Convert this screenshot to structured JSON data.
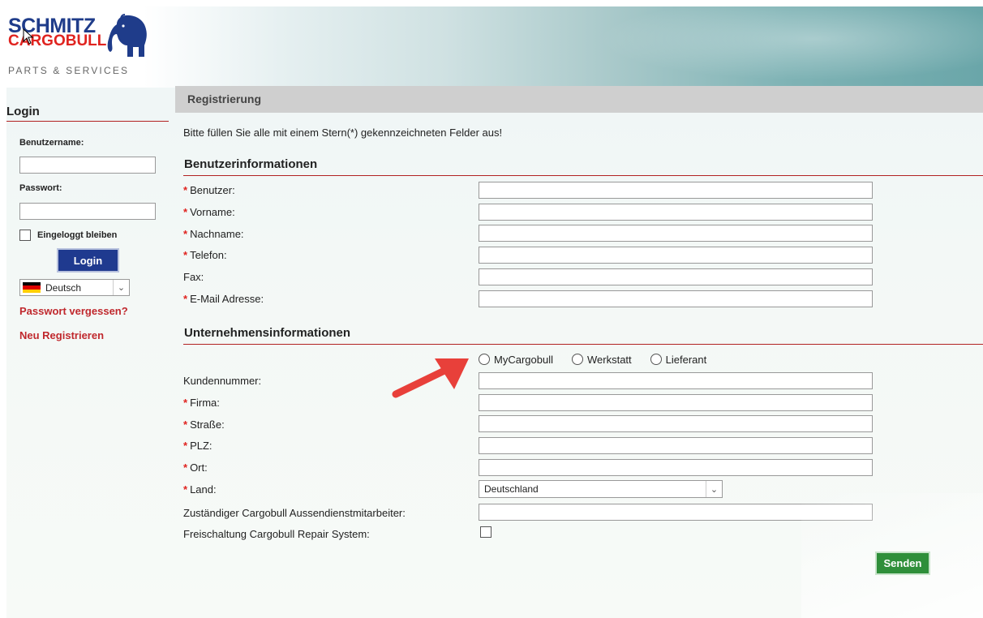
{
  "logo": {
    "line1": "SCHMITZ",
    "line2": "CARGOBULL",
    "subtitle": "PARTS & SERVICES"
  },
  "sidebar": {
    "title": "Login",
    "username_label": "Benutzername:",
    "password_label": "Passwort:",
    "stay_logged_in_label": "Eingeloggt bleiben",
    "login_button": "Login",
    "language": "Deutsch",
    "forgot_password": "Passwort vergessen?",
    "register": "Neu Registrieren"
  },
  "main": {
    "bar_title": "Registrierung",
    "intro": "Bitte füllen Sie alle mit einem Stern(*) gekennzeichneten Felder aus!",
    "section_user": "Benutzerinformationen",
    "user_fields": [
      {
        "label": "Benutzer:",
        "required": true
      },
      {
        "label": "Vorname:",
        "required": true
      },
      {
        "label": "Nachname:",
        "required": true
      },
      {
        "label": "Telefon:",
        "required": true
      },
      {
        "label": "Fax:",
        "required": false
      },
      {
        "label": "E-Mail Adresse:",
        "required": true
      }
    ],
    "section_company": "Unternehmensinformationen",
    "radio_options": [
      "MyCargobull",
      "Werkstatt",
      "Lieferant"
    ],
    "company_fields": [
      {
        "label": "Kundennummer:",
        "required": false
      },
      {
        "label": "Firma:",
        "required": true
      },
      {
        "label": "Straße:",
        "required": true
      },
      {
        "label": "PLZ:",
        "required": true
      },
      {
        "label": "Ort:",
        "required": true
      },
      {
        "label": "Land:",
        "required": true
      },
      {
        "label": "Zuständiger Cargobull Aussendienstmitarbeiter:",
        "required": false
      },
      {
        "label": "Freischaltung Cargobull Repair System:",
        "required": false
      }
    ],
    "country_value": "Deutschland",
    "send_button": "Senden"
  },
  "colors": {
    "brand_blue": "#1f3c8a",
    "brand_red": "#e0231f",
    "link_red": "#c0282d",
    "send_green": "#2f8f3a",
    "annotation_arrow": "#e8403a"
  }
}
